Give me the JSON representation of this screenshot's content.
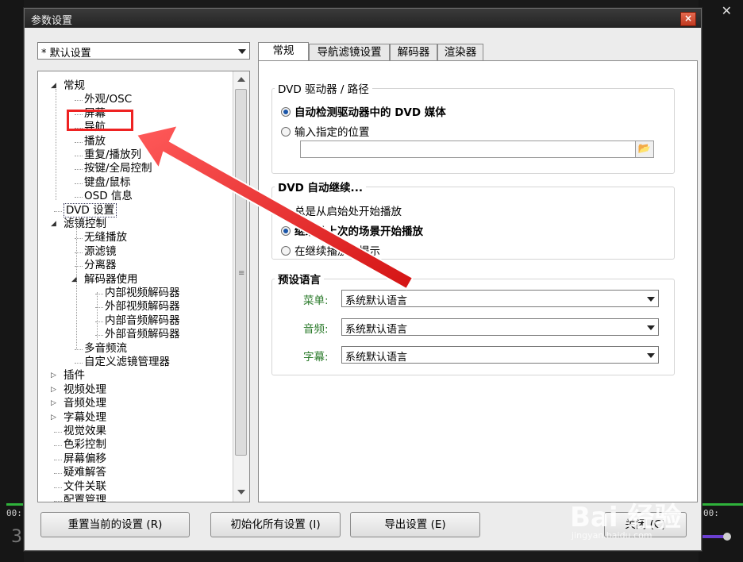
{
  "window": {
    "title": "参数设置",
    "close_glyph": "×"
  },
  "background": {
    "time_left": "00:",
    "time_right": "00:",
    "corner_digit": "3"
  },
  "profile": {
    "selected": "* 默认设置"
  },
  "tree": {
    "items": [
      {
        "label": "常规",
        "exp": "◢"
      },
      {
        "label": "外观/OSC"
      },
      {
        "label": "屏幕"
      },
      {
        "label": "导航"
      },
      {
        "label": "播放"
      },
      {
        "label": "重复/播放列"
      },
      {
        "label": "按键/全局控制"
      },
      {
        "label": "键盘/鼠标"
      },
      {
        "label": "OSD 信息"
      },
      {
        "label": "DVD 设置"
      },
      {
        "label": "滤镜控制",
        "exp": "◢"
      },
      {
        "label": "无缝播放"
      },
      {
        "label": "源滤镜"
      },
      {
        "label": "分离器"
      },
      {
        "label": "解码器使用",
        "exp": "◢"
      },
      {
        "label": "内部视频解码器"
      },
      {
        "label": "外部视频解码器"
      },
      {
        "label": "内部音频解码器"
      },
      {
        "label": "外部音频解码器"
      },
      {
        "label": "多音频流"
      },
      {
        "label": "自定义滤镜管理器"
      },
      {
        "label": "插件",
        "exp": "▷"
      },
      {
        "label": "视频处理",
        "exp": "▷"
      },
      {
        "label": "音频处理",
        "exp": "▷"
      },
      {
        "label": "字幕处理",
        "exp": "▷"
      },
      {
        "label": "视觉效果"
      },
      {
        "label": "色彩控制"
      },
      {
        "label": "屏幕偏移"
      },
      {
        "label": "疑难解答"
      },
      {
        "label": "文件关联"
      },
      {
        "label": "配置管理"
      }
    ]
  },
  "tabs": [
    "常规",
    "导航滤镜设置",
    "解码器",
    "渲染器"
  ],
  "dvd_drive": {
    "title": "DVD 驱动器 / 路径",
    "option_auto": "自动检测驱动器中的 DVD 媒体",
    "option_manual": "输入指定的位置",
    "path_value": ""
  },
  "dvd_resume": {
    "title": "DVD 自动继续...",
    "option_start": "总是从启始处开始播放",
    "option_last": "继续从上次的场景开始播放",
    "option_prompt": "在继续播放前提示"
  },
  "language": {
    "title": "预设语言",
    "menu_label": "菜单:",
    "menu_value": "系统默认语言",
    "audio_label": "音频:",
    "audio_value": "系统默认语言",
    "subtitle_label": "字幕:",
    "subtitle_value": "系统默认语言",
    "label_color": "#2a7a2a"
  },
  "buttons": {
    "reset": "重置当前的设置 (R)",
    "init_all": "初始化所有设置 (I)",
    "export": "导出设置 (E)",
    "close": "关闭 (C)"
  },
  "annotation": {
    "box_color": "#e22222",
    "arrow_color": "#e22222"
  },
  "watermark": {
    "text": "Bai 经验",
    "url": "jingyan.baidu.com"
  }
}
